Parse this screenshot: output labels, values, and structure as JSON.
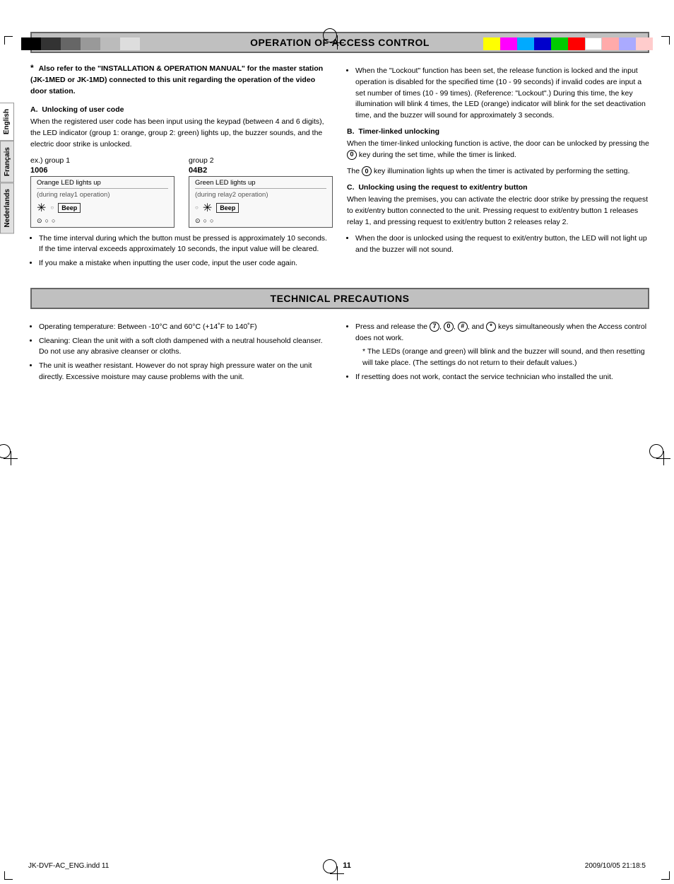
{
  "page": {
    "number": "11",
    "footer_left": "JK-DVF-AC_ENG.indd   11",
    "footer_right": "2009/10/05   21:18:5"
  },
  "color_bars_left": [
    "#000000",
    "#333333",
    "#666666",
    "#999999",
    "#bbbbbb",
    "#dddddd"
  ],
  "color_bars_right": [
    "#ffff00",
    "#ff00ff",
    "#00ffff",
    "#ff0000",
    "#00ff00",
    "#0000ff",
    "#ffffff",
    "#ff9999",
    "#ccccff",
    "#ffcccc"
  ],
  "lang_tabs": [
    "English",
    "Français",
    "Nederlands"
  ],
  "active_lang": "English",
  "section1": {
    "title": "OPERATION OF ACCESS CONTROL",
    "intro_star": "*",
    "intro_text": "Also refer to the \"INSTALLATION & OPERATION MANUAL\" for the master station (JK-1MED or JK-1MD) connected to this unit regarding the operation of the video door station.",
    "subsection_a": {
      "label": "A.",
      "heading": "Unlocking of user code",
      "body": "When the registered user code has been input using the keypad (between 4 and 6 digits), the LED indicator (group 1: orange, group 2: green) lights up, the buzzer sounds, and the electric door strike is unlocked.",
      "example_label": "ex.) group 1",
      "example_code1": "1006",
      "example_group2_label": "group 2",
      "example_code2": "04B2",
      "led_box1_top": "Orange LED lights up",
      "led_box1_sub": "(during relay1 operation)",
      "led_box2_top": "Green LED lights up",
      "led_box2_sub": "(during relay2 operation)",
      "beep": "Beep",
      "bullets": [
        "The time interval during which the button must be pressed is approximately 10 seconds. If the time interval exceeds approximately 10 seconds, the input value will be cleared.",
        "If you make a mistake when inputting the user code, input the user code again."
      ]
    },
    "right_col": {
      "bullet1": "When the \"Lockout\" function has been set, the release function is locked and the input operation is disabled for the specified time (10 - 99 seconds) if invalid codes are input a set number of times (10 - 99 times). (Reference: \"Lockout\".) During this time, the key illumination will blink 4 times, the LED (orange) indicator will blink for the set deactivation time, and the buzzer will sound for approximately 3 seconds.",
      "subsection_b": {
        "label": "B.",
        "heading": "Timer-linked unlocking",
        "body1": "When the timer-linked unlocking function is active, the door can be unlocked by pressing the",
        "key_0": "0",
        "body1b": "key during the set time, while the timer is linked.",
        "body2": "The",
        "key_0b": "0",
        "body2b": "key illumination lights up when the timer is activated by performing the setting."
      },
      "subsection_c": {
        "label": "C.",
        "heading": "Unlocking using the request to exit/entry button",
        "body": "When leaving the premises, you can activate the electric door strike by pressing the request to exit/entry button connected to the unit. Pressing request to exit/entry button 1 releases relay 1, and pressing request to exit/entry button 2 releases relay 2.",
        "bullet": "When the door is unlocked using the request to exit/entry button, the LED will not light up and the buzzer will not sound."
      }
    }
  },
  "section2": {
    "title": "TECHNICAL PRECAUTIONS",
    "left_bullets": [
      "Operating temperature: Between -10°C and 60°C (+14˚F to 140˚F)",
      "Cleaning: Clean the unit with a soft cloth dampened with a neutral household cleanser.  Do not use any abrasive cleanser or cloths.",
      "The unit is weather resistant. However do not spray high pressure water on the unit directly. Excessive moisture may cause problems with the unit."
    ],
    "right_bullets": [
      {
        "text_pre": "Press and release the",
        "keys": [
          "7",
          "0",
          "#",
          "*"
        ],
        "text_post": "keys simultaneously when the Access control does not work.",
        "sub_note": "* The LEDs (orange and green) will blink and the buzzer will sound, and then resetting will take place. (The settings do not return to their default values.)"
      },
      {
        "text": "If resetting does not work, contact the service technician who installed the unit."
      }
    ]
  }
}
